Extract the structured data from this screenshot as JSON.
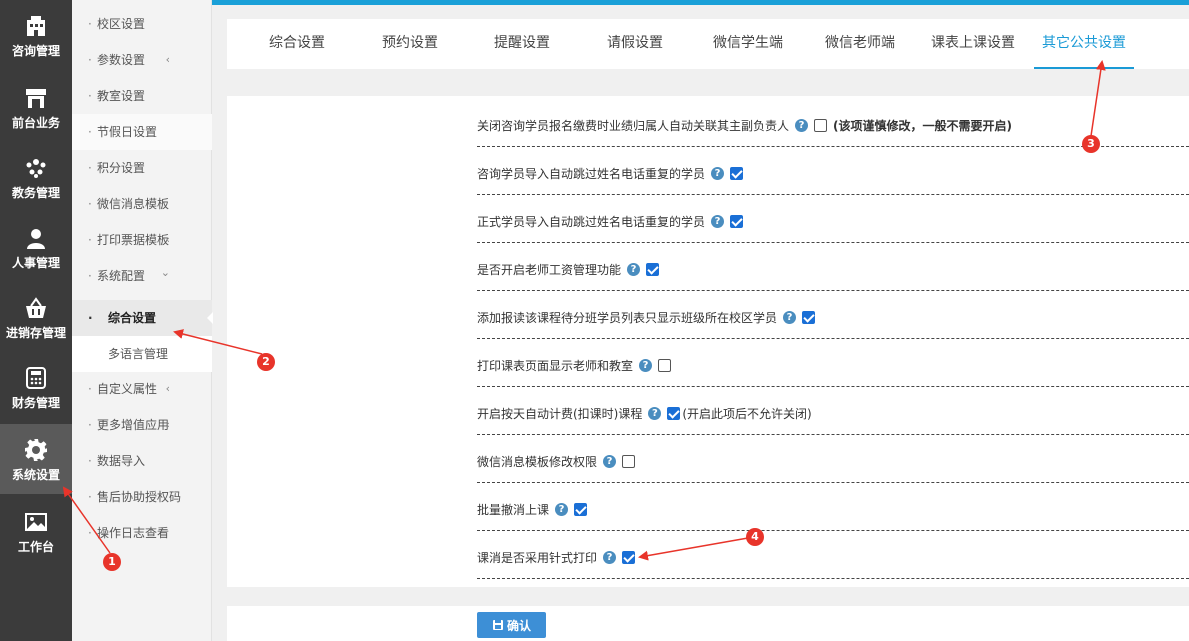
{
  "rail": {
    "items": [
      {
        "label": "咨询管理",
        "icon": "building-icon"
      },
      {
        "label": "前台业务",
        "icon": "store-icon"
      },
      {
        "label": "教务管理",
        "icon": "users-group-icon"
      },
      {
        "label": "人事管理",
        "icon": "person-icon"
      },
      {
        "label": "进销存管理",
        "icon": "basket-icon"
      },
      {
        "label": "财务管理",
        "icon": "calculator-icon"
      },
      {
        "label": "系统设置",
        "icon": "gear-icon"
      },
      {
        "label": "工作台",
        "icon": "image-icon"
      }
    ],
    "active_index": 6
  },
  "submenu": {
    "items": [
      {
        "label": "校区设置"
      },
      {
        "label": "参数设置",
        "chevron": "‹"
      },
      {
        "label": "教室设置"
      },
      {
        "label": "节假日设置"
      },
      {
        "label": "积分设置"
      },
      {
        "label": "微信消息模板"
      },
      {
        "label": "打印票据模板",
        "chevron": "‹"
      },
      {
        "label": "系统配置",
        "chevron": "⌄"
      },
      {
        "label": "综合设置"
      },
      {
        "label": "多语言管理"
      },
      {
        "label": "自定义属性",
        "chevron": "‹"
      },
      {
        "label": "更多增值应用",
        "chevron": "‹"
      },
      {
        "label": "数据导入"
      },
      {
        "label": "售后协助授权码"
      },
      {
        "label": "操作日志查看"
      }
    ]
  },
  "tabs": {
    "items": [
      "综合设置",
      "预约设置",
      "提醒设置",
      "请假设置",
      "微信学生端",
      "微信老师端",
      "课表上课设置",
      "其它公共设置"
    ],
    "active_index": 7
  },
  "settings": {
    "rows": [
      {
        "label": "关闭咨询学员报名缴费时业绩归属人自动关联其主副负责人",
        "checked": false,
        "note": "(该项谨慎修改，一般不需要开启)"
      },
      {
        "label": "咨询学员导入自动跳过姓名电话重复的学员",
        "checked": true
      },
      {
        "label": "正式学员导入自动跳过姓名电话重复的学员",
        "checked": true
      },
      {
        "label": "是否开启老师工资管理功能",
        "checked": true
      },
      {
        "label": "添加报读该课程待分班学员列表只显示班级所在校区学员",
        "checked": true
      },
      {
        "label": "打印课表页面显示老师和教室",
        "checked": false
      },
      {
        "label": "开启按天自动计费(扣课时)课程",
        "checked": true,
        "note": "(开启此项后不允许关闭)"
      },
      {
        "label": "微信消息模板修改权限",
        "checked": false
      },
      {
        "label": "批量撤消上课",
        "checked": true
      },
      {
        "label": "课消是否采用针式打印",
        "checked": true
      }
    ],
    "help_glyph": "?"
  },
  "footer": {
    "confirm_label": "确认",
    "confirm_icon": "save-icon"
  },
  "annotations": {
    "badges": [
      "1",
      "2",
      "3",
      "4"
    ],
    "color": "#e8342a"
  },
  "colors": {
    "accent": "#1a9ad6",
    "rail_bg": "#3b3b3b",
    "checkbox": "#1a6fd6"
  }
}
